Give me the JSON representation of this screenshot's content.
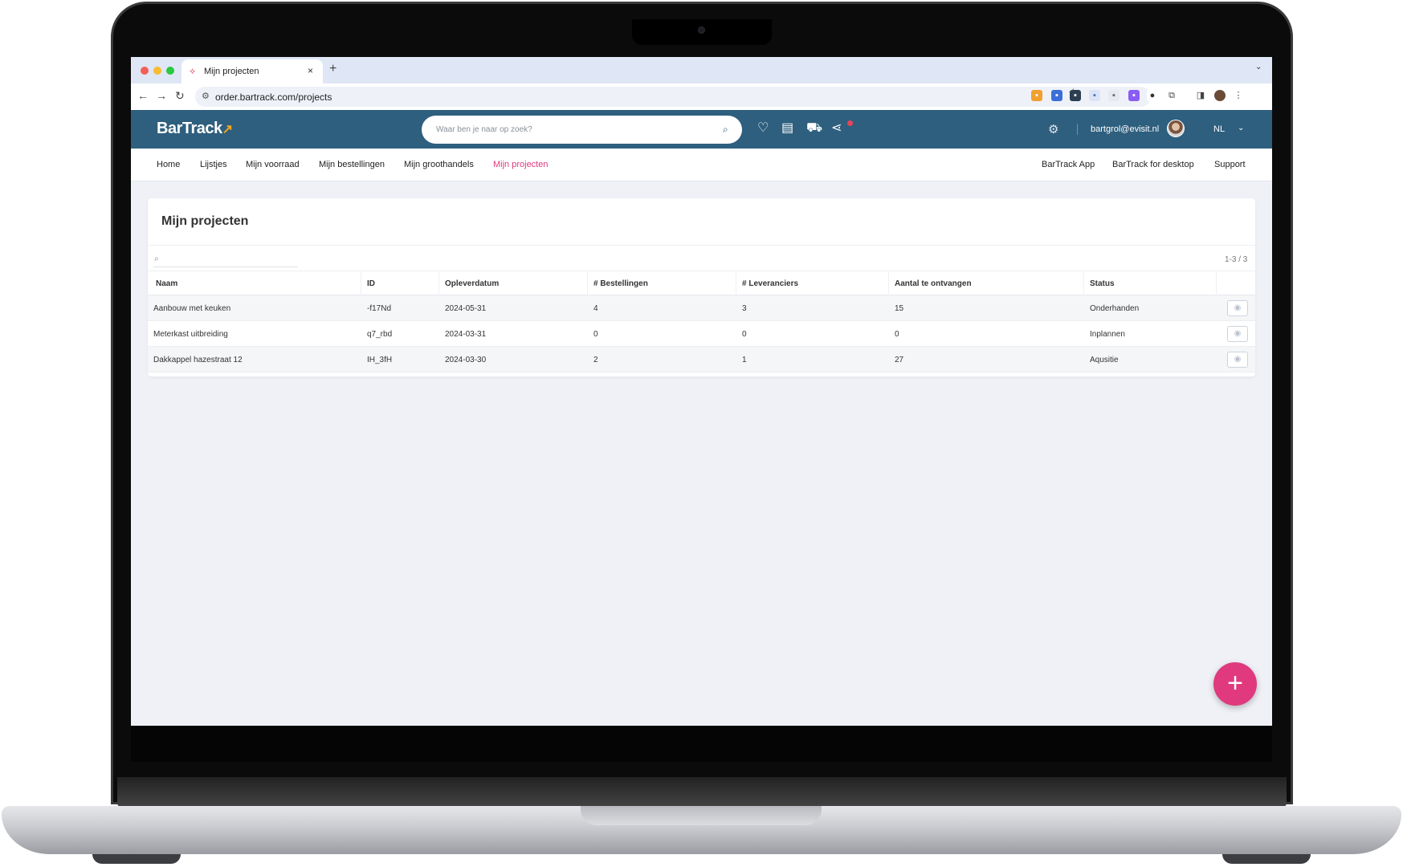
{
  "browser": {
    "tab_title": "Mijn projecten",
    "tab_close": "×",
    "new_tab": "+",
    "url": "order.bartrack.com/projects"
  },
  "header": {
    "logo": "BarTrack",
    "search_placeholder": "Waar ben je naar op zoek?",
    "user_email": "bartgrol@evisit.nl",
    "language": "NL"
  },
  "nav": {
    "left": [
      "Home",
      "Lijstjes",
      "Mijn voorraad",
      "Mijn bestellingen",
      "Mijn groothandels",
      "Mijn projecten"
    ],
    "active": "Mijn projecten",
    "right": [
      "BarTrack App",
      "BarTrack for desktop",
      "Support"
    ]
  },
  "page": {
    "title": "Mijn projecten",
    "pagination": "1-3 / 3"
  },
  "table": {
    "columns": [
      "Naam",
      "ID",
      "Opleverdatum",
      "# Bestellingen",
      "# Leveranciers",
      "Aantal te ontvangen",
      "Status"
    ],
    "rows": [
      [
        "Aanbouw met keuken",
        "-f17Nd",
        "2024-05-31",
        "4",
        "3",
        "15",
        "Onderhanden"
      ],
      [
        "Meterkast uitbreiding",
        "q7_rbd",
        "2024-03-31",
        "0",
        "0",
        "0",
        "Inplannen"
      ],
      [
        "Dakkappel hazestraat 12",
        "IH_3fH",
        "2024-03-30",
        "2",
        "1",
        "27",
        "Aqusitie"
      ]
    ]
  },
  "fab": {
    "label": "+"
  },
  "colors": {
    "header_bg": "#2e5f7e",
    "accent": "#e0397e",
    "page_bg": "#eff1f6"
  },
  "icons": {
    "header": [
      "heart-icon",
      "archive-icon",
      "cart-icon",
      "share-icon",
      "gear-icon"
    ],
    "row_action": "eye-icon"
  }
}
